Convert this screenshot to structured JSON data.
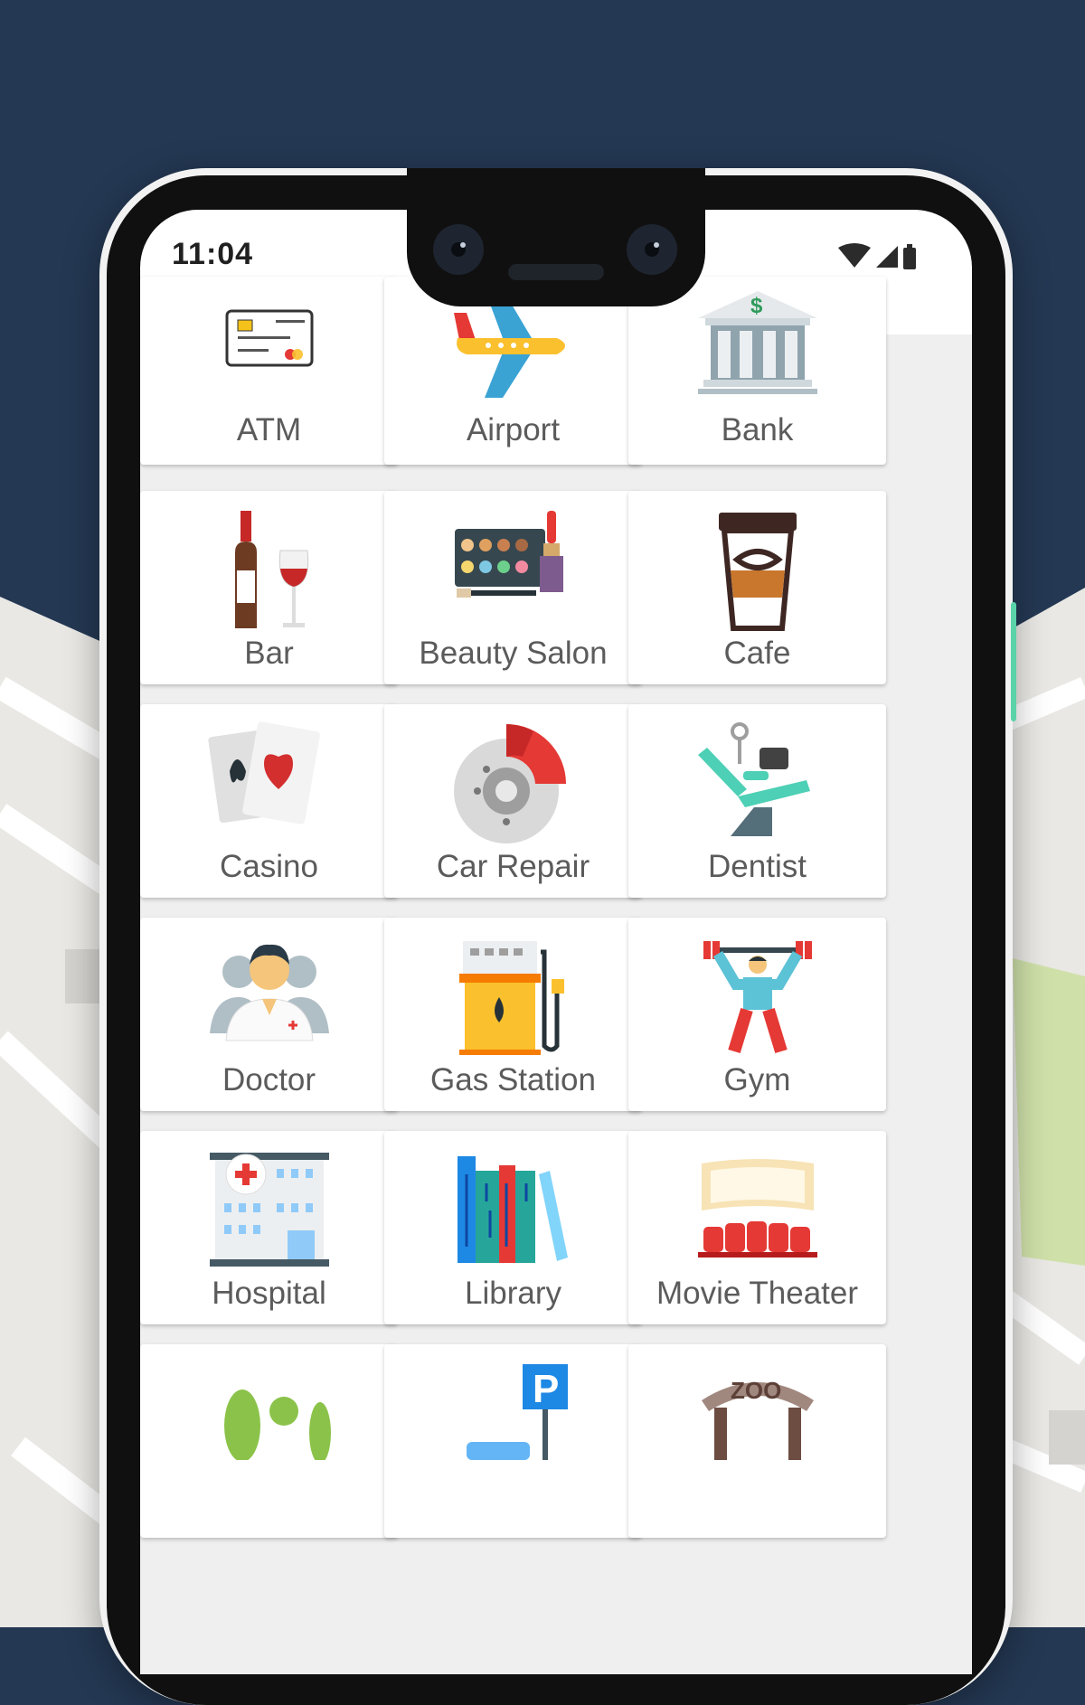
{
  "status": {
    "time": "11:04"
  },
  "places": [
    {
      "label": "ATM",
      "icon": "credit-card-icon"
    },
    {
      "label": "Airport",
      "icon": "airplane-icon"
    },
    {
      "label": "Bank",
      "icon": "bank-building-icon"
    },
    {
      "label": "Bar",
      "icon": "wine-bottle-glass-icon"
    },
    {
      "label": "Beauty Salon",
      "icon": "makeup-palette-icon"
    },
    {
      "label": "Cafe",
      "icon": "coffee-cup-icon"
    },
    {
      "label": "Casino",
      "icon": "playing-cards-icon"
    },
    {
      "label": "Car Repair",
      "icon": "brake-disc-icon"
    },
    {
      "label": "Dentist",
      "icon": "dental-chair-icon"
    },
    {
      "label": "Doctor",
      "icon": "doctor-icon"
    },
    {
      "label": "Gas Station",
      "icon": "fuel-pump-icon"
    },
    {
      "label": "Gym",
      "icon": "weightlifter-icon"
    },
    {
      "label": "Hospital",
      "icon": "hospital-building-icon"
    },
    {
      "label": "Library",
      "icon": "books-icon"
    },
    {
      "label": "Movie Theater",
      "icon": "cinema-screen-icon"
    },
    {
      "label": "",
      "icon": "park-trees-icon"
    },
    {
      "label": "",
      "icon": "parking-sign-icon"
    },
    {
      "label": "",
      "icon": "zoo-gate-icon"
    }
  ],
  "colors": {
    "background": "#243853",
    "accent": "#5ad3a8"
  }
}
